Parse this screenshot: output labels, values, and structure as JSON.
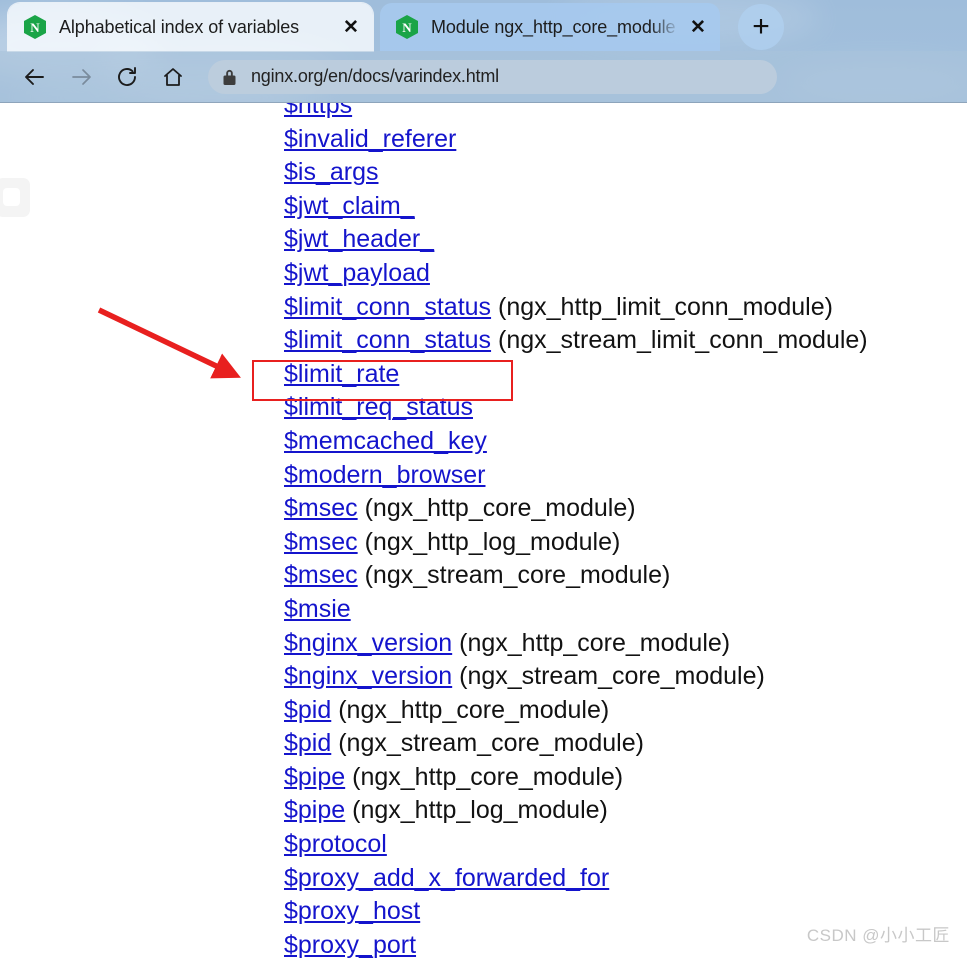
{
  "browser": {
    "tabs": [
      {
        "title": "Alphabetical index of variables",
        "favicon": "nginx-icon",
        "favicon_letter": "N",
        "active": true,
        "close_label": "✕"
      },
      {
        "title": "Module ngx_http_core_module",
        "favicon": "nginx-icon",
        "favicon_letter": "N",
        "active": false,
        "close_label": "✕"
      }
    ],
    "new_tab_label": "+",
    "toolbar": {
      "back_icon": "arrow-left-icon",
      "forward_icon": "arrow-right-icon",
      "reload_icon": "reload-icon",
      "home_icon": "home-icon",
      "lock_icon": "lock-icon",
      "url": "nginx.org/en/docs/varindex.html"
    }
  },
  "page": {
    "variables": [
      {
        "name": "$https",
        "module": ""
      },
      {
        "name": "$invalid_referer",
        "module": ""
      },
      {
        "name": "$is_args",
        "module": ""
      },
      {
        "name": "$jwt_claim_",
        "module": ""
      },
      {
        "name": "$jwt_header_",
        "module": ""
      },
      {
        "name": "$jwt_payload",
        "module": ""
      },
      {
        "name": "$limit_conn_status",
        "module": "(ngx_http_limit_conn_module)"
      },
      {
        "name": "$limit_conn_status",
        "module": "(ngx_stream_limit_conn_module)"
      },
      {
        "name": "$limit_rate",
        "module": ""
      },
      {
        "name": "$limit_req_status",
        "module": ""
      },
      {
        "name": "$memcached_key",
        "module": ""
      },
      {
        "name": "$modern_browser",
        "module": ""
      },
      {
        "name": "$msec",
        "module": "(ngx_http_core_module)"
      },
      {
        "name": "$msec",
        "module": "(ngx_http_log_module)"
      },
      {
        "name": "$msec",
        "module": "(ngx_stream_core_module)"
      },
      {
        "name": "$msie",
        "module": ""
      },
      {
        "name": "$nginx_version",
        "module": "(ngx_http_core_module)"
      },
      {
        "name": "$nginx_version",
        "module": "(ngx_stream_core_module)"
      },
      {
        "name": "$pid",
        "module": "(ngx_http_core_module)"
      },
      {
        "name": "$pid",
        "module": "(ngx_stream_core_module)"
      },
      {
        "name": "$pipe",
        "module": "(ngx_http_core_module)"
      },
      {
        "name": "$pipe",
        "module": "(ngx_http_log_module)"
      },
      {
        "name": "$protocol",
        "module": ""
      },
      {
        "name": "$proxy_add_x_forwarded_for",
        "module": ""
      },
      {
        "name": "$proxy_host",
        "module": ""
      },
      {
        "name": "$proxy_port",
        "module": ""
      }
    ]
  },
  "annotations": {
    "highlight_target": "$limit_rate",
    "color": "#e8201f"
  },
  "watermark": {
    "text": "CSDN @小小工匠"
  },
  "colors": {
    "link": "#1414cc",
    "annotation_red": "#e8201f",
    "nginx_green": "#1aa447",
    "page_background": "#ffffff"
  }
}
